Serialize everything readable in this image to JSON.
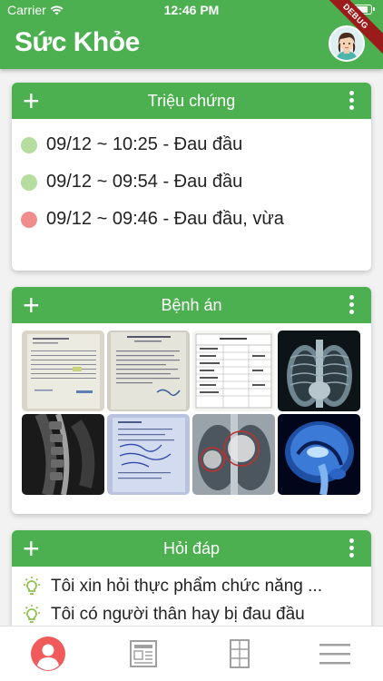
{
  "status_bar": {
    "carrier": "Carrier",
    "time": "12:46 PM",
    "battery_level": 0.9
  },
  "app": {
    "title": "Sức Khỏe",
    "debug_badge": "DEBUG"
  },
  "colors": {
    "primary": "#4caf50",
    "dot_green": "#b6dda0",
    "dot_red": "#f08e8e",
    "tab_active": "#f05a5a",
    "tab_inactive": "#a0a0a0"
  },
  "symptoms": {
    "title": "Triệu chứng",
    "items": [
      {
        "text": "09/12 ~ 10:25 - Đau đầu",
        "status": "green"
      },
      {
        "text": "09/12 ~ 09:54 - Đau đầu",
        "status": "green"
      },
      {
        "text": "09/12 ~ 09:46 - Đau đầu, vừa",
        "status": "red"
      }
    ]
  },
  "records": {
    "title": "Bệnh án",
    "images": [
      "lab-test-sheet",
      "medical-report",
      "test-results-table",
      "chest-xray",
      "spine-mri",
      "prescription-sheet",
      "chest-xray-highlighted",
      "brain-mri"
    ]
  },
  "qa": {
    "title": "Hỏi đáp",
    "items": [
      {
        "text": "Tôi xin hỏi thực phẩm chức năng ..."
      },
      {
        "text": "Tôi có người thân hay bị đau đầu"
      }
    ]
  },
  "tabs": [
    {
      "icon": "profile-icon",
      "active": true
    },
    {
      "icon": "news-icon",
      "active": false
    },
    {
      "icon": "records-icon",
      "active": false
    },
    {
      "icon": "menu-icon",
      "active": false
    }
  ]
}
